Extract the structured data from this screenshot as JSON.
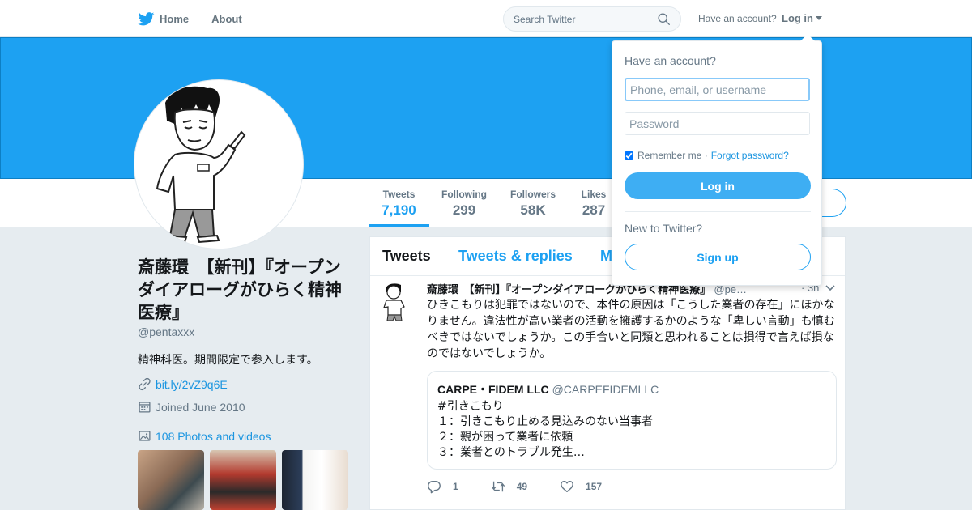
{
  "nav": {
    "home": "Home",
    "about": "About",
    "search_placeholder": "Search Twitter",
    "have_account": "Have an account?",
    "login": "Log in",
    "brand_color": "#1da1f2"
  },
  "profile": {
    "name": "斎藤環　【新刊】『オープンダイアローグがひらく精神医療』",
    "handle": "@pentaxxx",
    "bio": "精神科医。期間限定で参入します。",
    "link": "bit.ly/2vZ9q6E",
    "joined": "Joined June 2010",
    "photos": "108 Photos and videos"
  },
  "stats": [
    {
      "label": "Tweets",
      "value": "7,190"
    },
    {
      "label": "Following",
      "value": "299"
    },
    {
      "label": "Followers",
      "value": "58K"
    },
    {
      "label": "Likes",
      "value": "287"
    }
  ],
  "timeline": {
    "tabs": [
      "Tweets",
      "Tweets & replies",
      "M"
    ]
  },
  "tweet": {
    "name": "斎藤環　【新刊】『オープンダイアローグがひらく精神医療』",
    "handle": "@pe…",
    "time": "· 3h",
    "text": "ひきこもりは犯罪ではないので、本件の原因は「こうした業者の存在」にほかなりません。違法性が高い業者の活動を擁護するかのような「卑しい言動」も慎むべきではないでしょうか。この手合いと同類と思われることは損得で言えば損なのではないでしょうか。",
    "quote": {
      "name": "CARPE・FIDEM LLC",
      "handle": "@CARPEFIDEMLLC",
      "text": "#引きこもり\n１：引きこもり止める見込みのない当事者\n２：親が困って業者に依頼\n３：業者とのトラブル発生…"
    },
    "replies": "1",
    "retweets": "49",
    "likes": "157"
  },
  "login_dropdown": {
    "title": "Have an account?",
    "username_placeholder": "Phone, email, or username",
    "password_placeholder": "Password",
    "remember": "Remember me",
    "forgot": "Forgot password?",
    "login_button": "Log in",
    "new_to_twitter": "New to Twitter?",
    "signup_button": "Sign up"
  }
}
